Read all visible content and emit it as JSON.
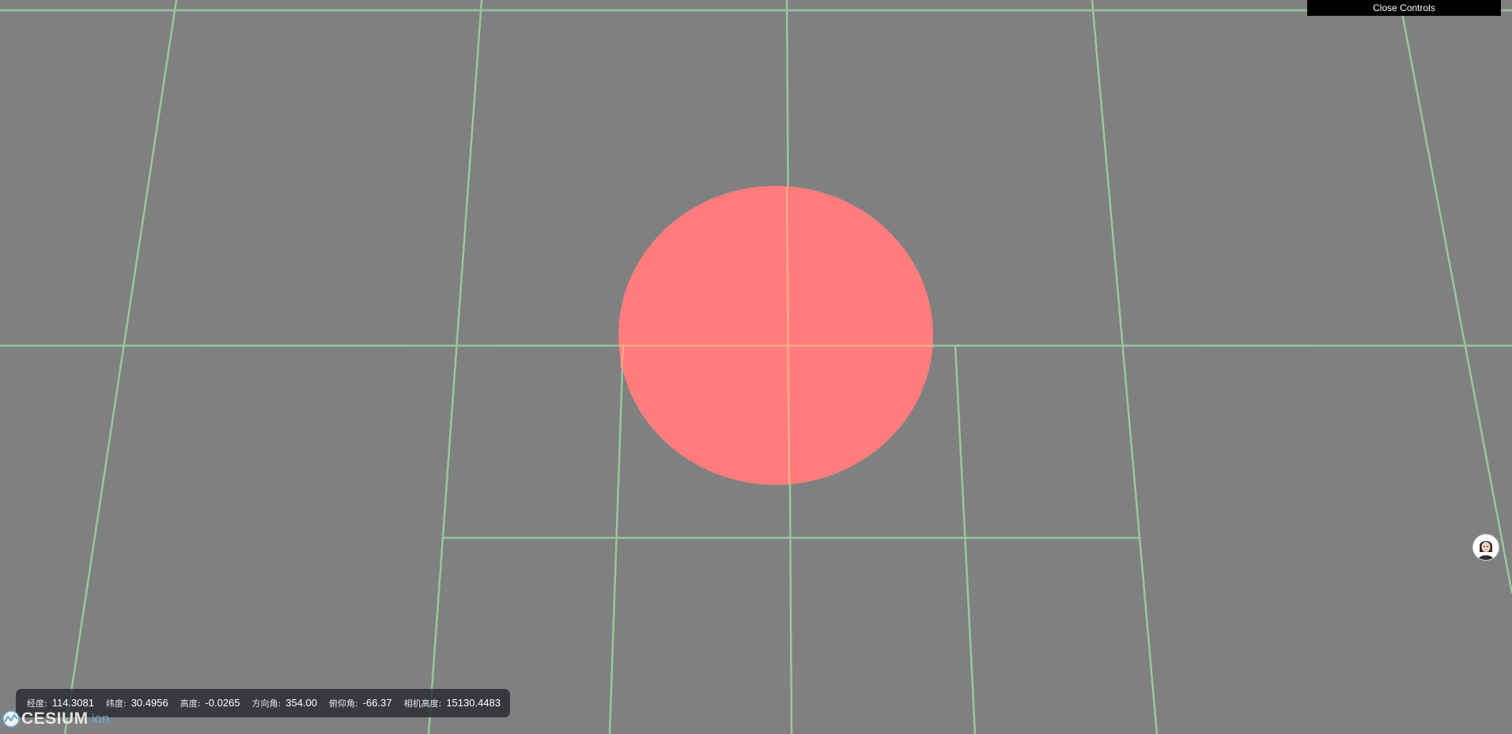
{
  "controls": {
    "close_label": "Close Controls"
  },
  "status_bar": {
    "items": [
      {
        "label": "经度:",
        "value": "114.3081"
      },
      {
        "label": "纬度:",
        "value": "30.4956"
      },
      {
        "label": "高度:",
        "value": "-0.0265"
      },
      {
        "label": "方向角:",
        "value": "354.00"
      },
      {
        "label": "俯仰角:",
        "value": "-66.37"
      },
      {
        "label": "相机高度:",
        "value": "15130.4483"
      }
    ]
  },
  "logo": {
    "brand": "CESIUM",
    "suffix": "ion"
  },
  "scene": {
    "background_color": "#808080",
    "grid_color": "#9fd39f",
    "circle_color": "#ff7d7d",
    "highlight_color": "#ffb088"
  },
  "avatar": {
    "icon": "user-avatar-icon"
  }
}
